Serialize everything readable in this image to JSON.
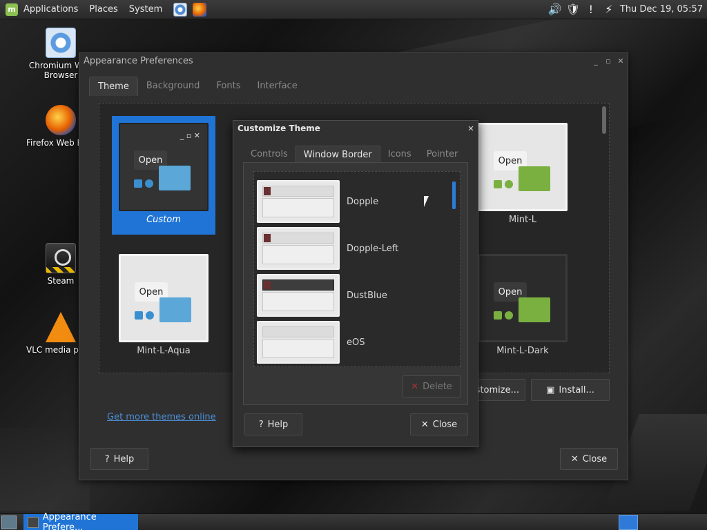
{
  "top_panel": {
    "menu": [
      "Applications",
      "Places",
      "System"
    ],
    "clock": "Thu Dec 19, 05:57"
  },
  "desktop_icons": [
    {
      "label": "Chromium Web Browser",
      "icon": "chromium-icon"
    },
    {
      "label": "Firefox Web Browser",
      "icon": "firefox-icon"
    },
    {
      "label": "Steam",
      "icon": "steam-icon"
    },
    {
      "label": "VLC media player",
      "icon": "vlc-icon"
    }
  ],
  "main_window": {
    "title": "Appearance Preferences",
    "tabs": [
      "Theme",
      "Background",
      "Fonts",
      "Interface"
    ],
    "active_tab": "Theme",
    "themes": [
      {
        "name": "Custom",
        "selected": true
      },
      {
        "name": "Mint-L",
        "selected": false
      },
      {
        "name": "Mint-L-Aqua",
        "selected": false
      },
      {
        "name": "Mint-L-Dark",
        "selected": false
      }
    ],
    "open_label": "Open",
    "customize_label": "Customize...",
    "install_label": "Install...",
    "link_text": "Get more themes online",
    "help_label": "Help",
    "close_label": "Close"
  },
  "dialog": {
    "title": "Customize Theme",
    "tabs": [
      "Controls",
      "Window Border",
      "Icons",
      "Pointer"
    ],
    "active_tab": "Window Border",
    "borders": [
      "Dopple",
      "Dopple-Left",
      "DustBlue",
      "eOS"
    ],
    "delete_label": "Delete",
    "help_label": "Help",
    "close_label": "Close"
  },
  "taskbar": {
    "window_label": "Appearance Prefere..."
  },
  "colors": {
    "accent": "#1f74d6",
    "link": "#4c8fd8",
    "window_bg": "#2f2f2f"
  }
}
